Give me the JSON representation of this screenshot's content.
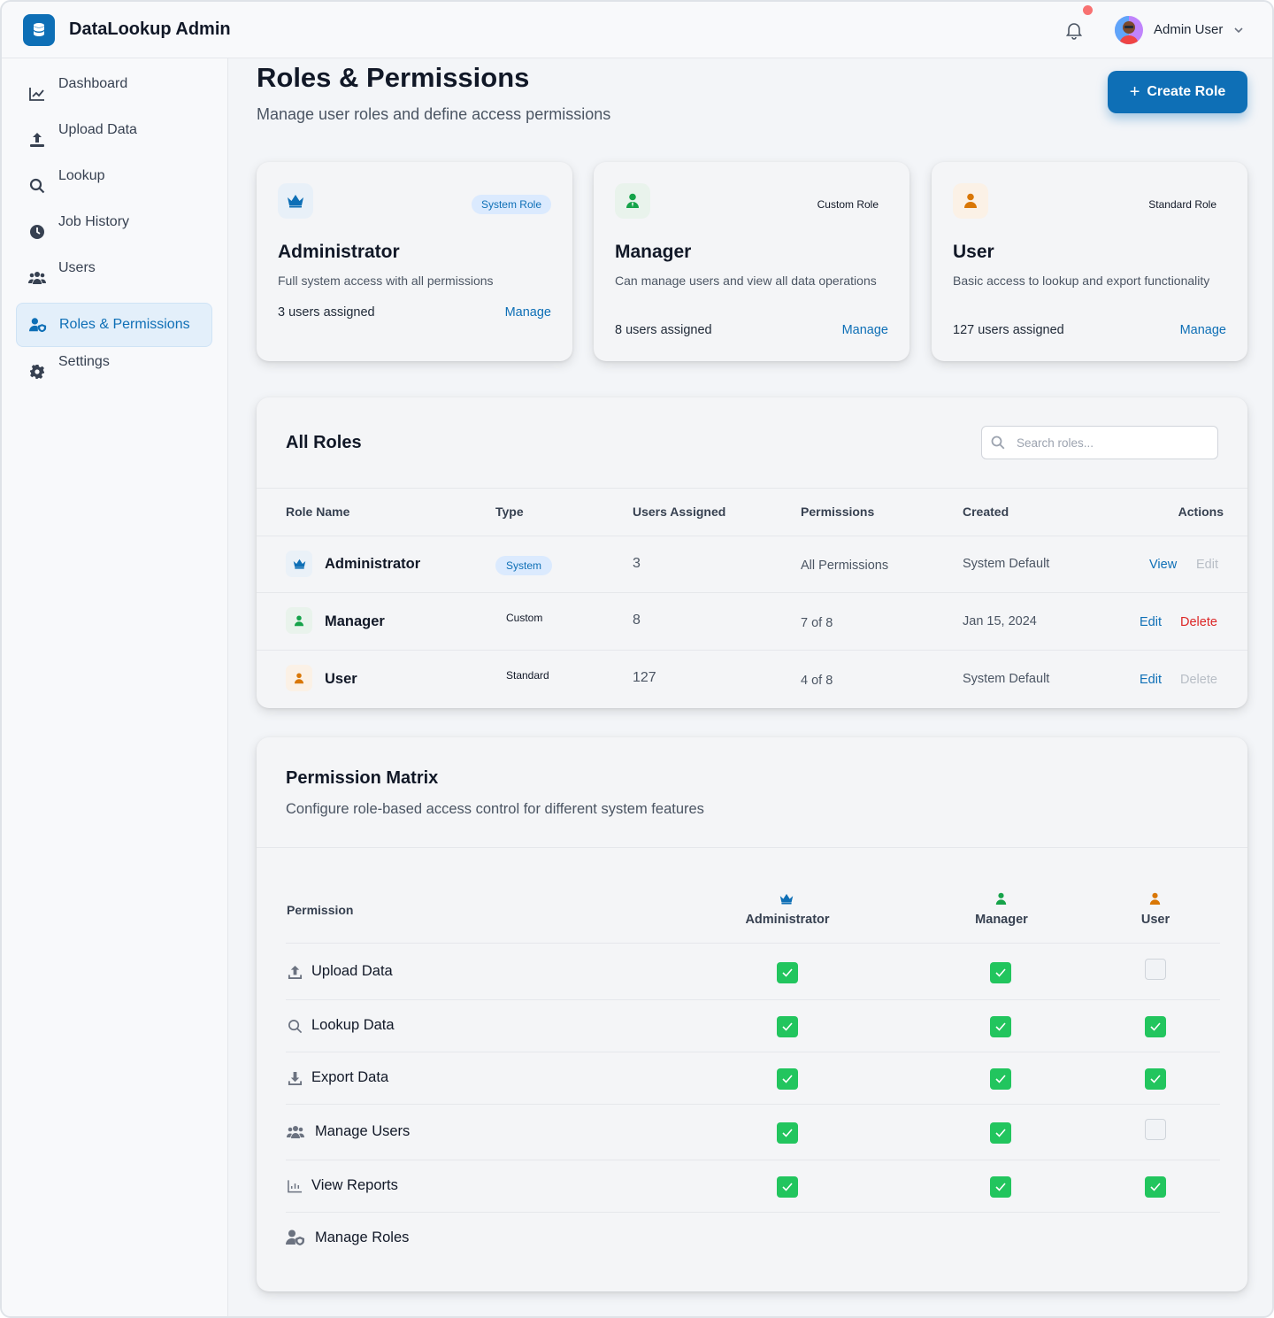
{
  "app": {
    "title": "DataLookup Admin"
  },
  "header": {
    "user_name": "Admin User"
  },
  "sidebar": {
    "items": [
      {
        "label": "Dashboard"
      },
      {
        "label": "Upload Data"
      },
      {
        "label": "Lookup"
      },
      {
        "label": "Job History"
      },
      {
        "label": "Users"
      },
      {
        "label": "Roles & Permissions",
        "active": true
      },
      {
        "label": "Settings"
      }
    ]
  },
  "page": {
    "title": "Roles & Permissions",
    "subtitle": "Manage user roles and define access permissions",
    "create_button": "Create Role"
  },
  "role_cards": [
    {
      "badge": "System Role",
      "title": "Administrator",
      "description": "Full system access with all permissions",
      "users": "3 users assigned",
      "manage": "Manage",
      "icon": "crown-icon",
      "color": "#0e6fb6"
    },
    {
      "badge": "Custom Role",
      "title": "Manager",
      "description": "Can manage users and view all data operations",
      "users": "8 users assigned",
      "manage": "Manage",
      "icon": "user-tie-icon",
      "color": "#16a34a"
    },
    {
      "badge": "Standard Role",
      "title": "User",
      "description": "Basic access to lookup and export functionality",
      "users": "127 users assigned",
      "manage": "Manage",
      "icon": "user-icon",
      "color": "#d97706"
    }
  ],
  "all_roles": {
    "title": "All Roles",
    "search_placeholder": "Search roles...",
    "columns": [
      "Role Name",
      "Type",
      "Users Assigned",
      "Permissions",
      "Created",
      "Actions"
    ],
    "rows": [
      {
        "name": "Administrator",
        "type": "System",
        "users": "3",
        "permissions": "All Permissions",
        "created": "System Default",
        "action1": "View",
        "action2": "Edit"
      },
      {
        "name": "Manager",
        "type": "Custom",
        "users": "8",
        "permissions": "7 of 8",
        "created": "Jan 15, 2024",
        "action1": "Edit",
        "action2": "Delete"
      },
      {
        "name": "User",
        "type": "Standard",
        "users": "127",
        "permissions": "4 of 8",
        "created": "System Default",
        "action1": "Edit",
        "action2": "Delete"
      }
    ]
  },
  "matrix": {
    "title": "Permission Matrix",
    "subtitle": "Configure role-based access control for different system features",
    "permission_header": "Permission",
    "roles": [
      "Administrator",
      "Manager",
      "User"
    ],
    "rows": [
      {
        "label": "Upload Data",
        "icon": "upload-icon",
        "values": [
          true,
          true,
          false
        ]
      },
      {
        "label": "Lookup Data",
        "icon": "search-icon",
        "values": [
          true,
          true,
          true
        ]
      },
      {
        "label": "Export Data",
        "icon": "download-icon",
        "values": [
          true,
          true,
          true
        ]
      },
      {
        "label": "Manage Users",
        "icon": "users-icon",
        "values": [
          true,
          true,
          false
        ]
      },
      {
        "label": "View Reports",
        "icon": "chart-icon",
        "values": [
          true,
          true,
          true
        ]
      },
      {
        "label": "Manage Roles",
        "icon": "user-shield-icon",
        "values": []
      }
    ]
  }
}
